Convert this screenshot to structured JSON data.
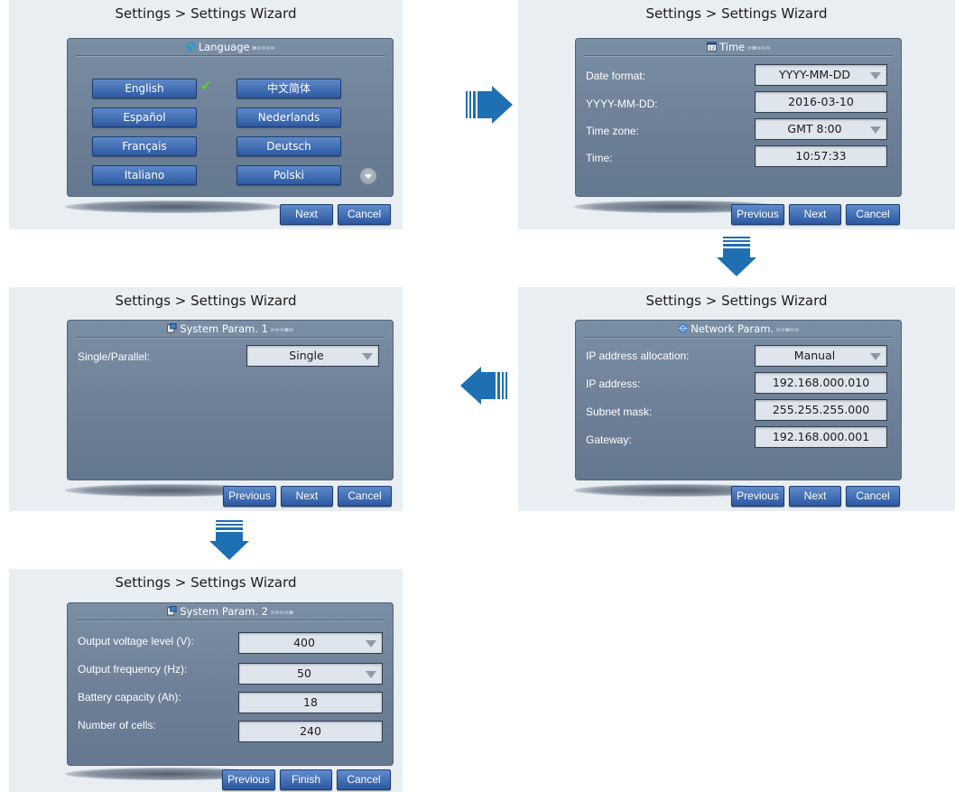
{
  "screen_title": "Settings > Settings Wizard",
  "language": {
    "header": "Language",
    "progress": "»»»»",
    "options": [
      "English",
      "中文简体",
      "Español",
      "Nederlands",
      "Français",
      "Deutsch",
      "Italiano",
      "Polski"
    ],
    "selected": "English"
  },
  "time": {
    "header": "Time",
    "icon_text": "12",
    "rows": [
      {
        "label": "Date format:",
        "value": "YYYY-MM-DD",
        "type": "select"
      },
      {
        "label": "YYYY-MM-DD:",
        "value": "2016-03-10",
        "type": "input"
      },
      {
        "label": "Time zone:",
        "value": "GMT 8:00",
        "type": "select"
      },
      {
        "label": "Time:",
        "value": "10:57:33",
        "type": "input"
      }
    ]
  },
  "network": {
    "header": "Network Param.",
    "rows": [
      {
        "label": "IP address allocation:",
        "value": "Manual",
        "type": "select"
      },
      {
        "label": "IP address:",
        "value": "192.168.000.010",
        "type": "input"
      },
      {
        "label": "Subnet mask:",
        "value": "255.255.255.000",
        "type": "input"
      },
      {
        "label": "Gateway:",
        "value": "192.168.000.001",
        "type": "input"
      }
    ]
  },
  "system1": {
    "header": "System Param. 1",
    "rows": [
      {
        "label": "Single/Parallel:",
        "value": "Single",
        "type": "select"
      }
    ]
  },
  "system2": {
    "header": "System Param. 2",
    "rows": [
      {
        "label": "Output voltage level (V):",
        "value": "400",
        "type": "select"
      },
      {
        "label": "Output frequency (Hz):",
        "value": "50",
        "type": "select"
      },
      {
        "label": "Battery capacity (Ah):",
        "value": "18",
        "type": "input"
      },
      {
        "label": "Number of cells:",
        "value": "240",
        "type": "input"
      }
    ]
  },
  "buttons": {
    "next": "Next",
    "cancel": "Cancel",
    "previous": "Previous",
    "finish": "Finish"
  },
  "colors": {
    "panel": "#6c7f96",
    "button": "#2d5aa2",
    "arrow": "#1f6fb3",
    "check": "#5ed12a"
  }
}
